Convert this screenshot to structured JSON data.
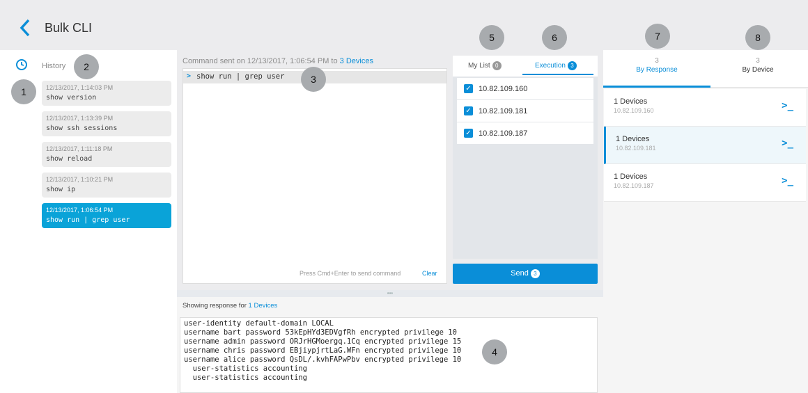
{
  "header": {
    "title": "Bulk CLI"
  },
  "history": {
    "label": "History",
    "items": [
      {
        "time": "12/13/2017, 1:14:03 PM",
        "cmd": "show version"
      },
      {
        "time": "12/13/2017, 1:13:39 PM",
        "cmd": "show ssh sessions"
      },
      {
        "time": "12/13/2017, 1:11:18 PM",
        "cmd": "show reload"
      },
      {
        "time": "12/13/2017, 1:10:21 PM",
        "cmd": "show ip"
      },
      {
        "time": "12/13/2017, 1:06:54 PM",
        "cmd": "show run | grep user"
      }
    ]
  },
  "command": {
    "sent_prefix": "Command sent on 12/13/2017, 1:06:54 PM to",
    "devices_link": "3 Devices",
    "prompt": ">",
    "text": "show run | grep user",
    "hint": "Press Cmd+Enter to send command",
    "clear": "Clear"
  },
  "devices": {
    "tab_mylist": "My List",
    "tab_mylist_count": "0",
    "tab_execution": "Execution",
    "tab_execution_count": "3",
    "list": [
      "10.82.109.160",
      "10.82.109.181",
      "10.82.109.187"
    ],
    "send_label": "Send",
    "send_count": "3"
  },
  "response": {
    "showing_prefix": "Showing response for",
    "showing_link": "1 Devices",
    "divider": "•••",
    "lines": [
      "user-identity default-domain LOCAL",
      "username bart password 53kEpHYd3EDVgfRh encrypted privilege 10",
      "username admin password ORJrHGMoergq.1Cq encrypted privilege 15",
      "username chris password EBjiypjrtLaG.WFn encrypted privilege 10",
      "username alice password QsDL/.kvhFAPwPbv encrypted privilege 10",
      "  user-statistics accounting",
      "  user-statistics accounting"
    ]
  },
  "right": {
    "tab_response_count": "3",
    "tab_response_label": "By Response",
    "tab_device_count": "3",
    "tab_device_label": "By Device",
    "rows": [
      {
        "title": "1 Devices",
        "ip": "10.82.109.160"
      },
      {
        "title": "1 Devices",
        "ip": "10.82.109.181"
      },
      {
        "title": "1 Devices",
        "ip": "10.82.109.187"
      }
    ],
    "terminal_glyph": ">_"
  },
  "callouts": [
    "1",
    "2",
    "3",
    "4",
    "5",
    "6",
    "7",
    "8"
  ],
  "colors": {
    "accent": "#0a8ed8",
    "selected": "#0aa3d8",
    "callout": "#a8abae"
  }
}
